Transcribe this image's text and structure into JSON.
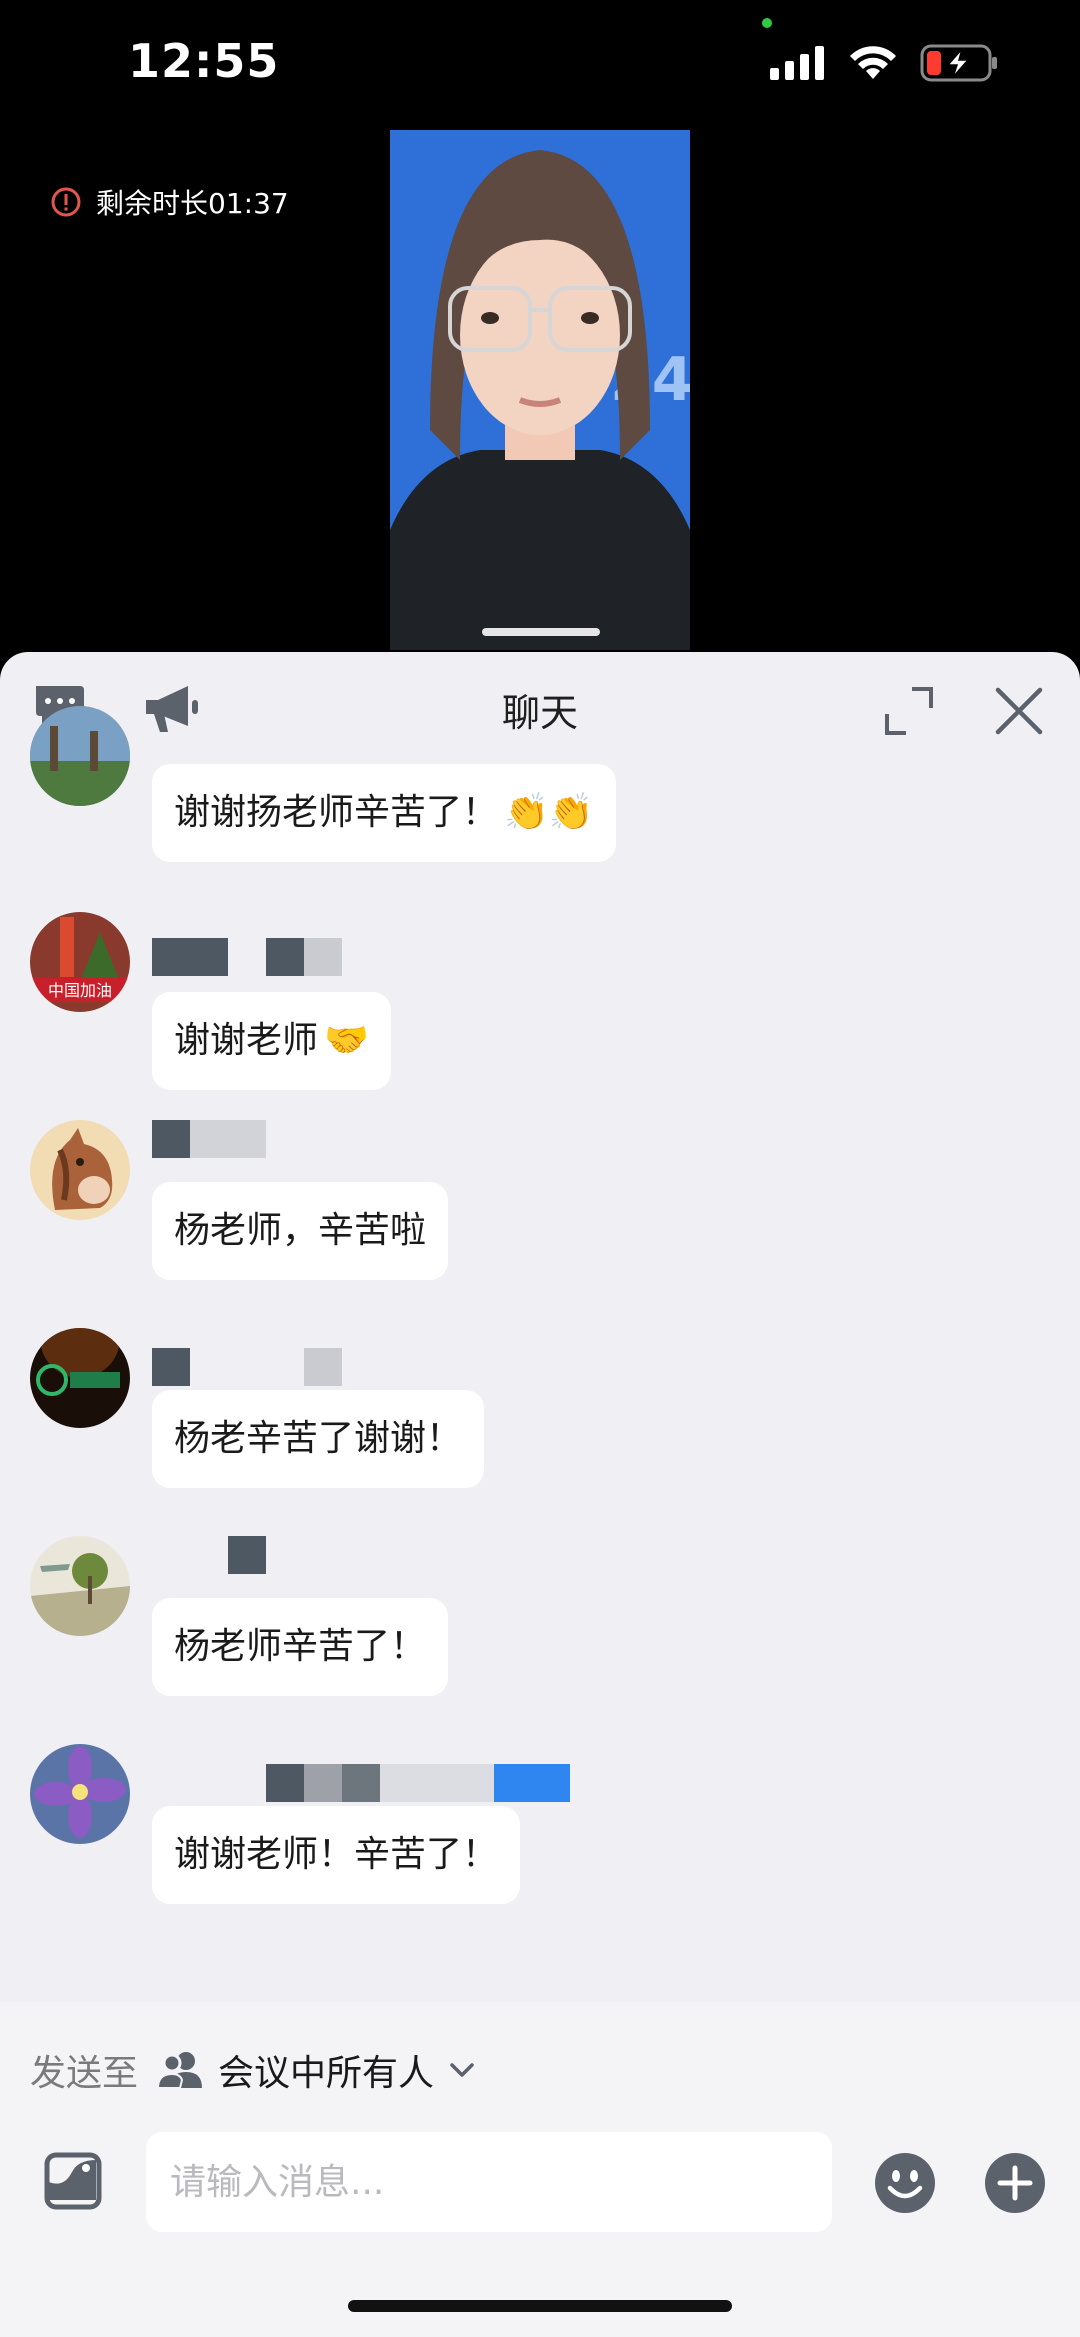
{
  "status_bar": {
    "time": "12:55"
  },
  "call": {
    "remaining_label": "剩余时长01:37"
  },
  "chat": {
    "title": "聊天",
    "messages": [
      {
        "text": "谢谢扬老师辛苦了！",
        "emoji": "👏👏"
      },
      {
        "text": "谢谢老师",
        "emoji": "🤝",
        "avatar_caption": "中国加油"
      },
      {
        "text": "杨老师，辛苦啦"
      },
      {
        "text": "杨老辛苦了谢谢！"
      },
      {
        "text": "杨老师辛苦了！"
      },
      {
        "text": "谢谢老师！辛苦了！"
      }
    ]
  },
  "footer": {
    "send_to_label": "发送至",
    "recipient": "会议中所有人",
    "input_placeholder": "请输入消息..."
  },
  "icons": {
    "settings": "chat-settings-icon",
    "announce": "megaphone-icon",
    "expand": "expand-icon",
    "close": "close-icon",
    "image": "image-icon",
    "emoji": "emoji-icon",
    "plus": "plus-icon",
    "people": "people-icon",
    "chevron": "chevron-down-icon"
  },
  "colors": {
    "panel_bg": "#efeff4",
    "bubble_bg": "#ffffff",
    "icon_gray": "#5b626b",
    "timer_icon": "#e2574c",
    "video_bg": "#2d6ed6"
  }
}
